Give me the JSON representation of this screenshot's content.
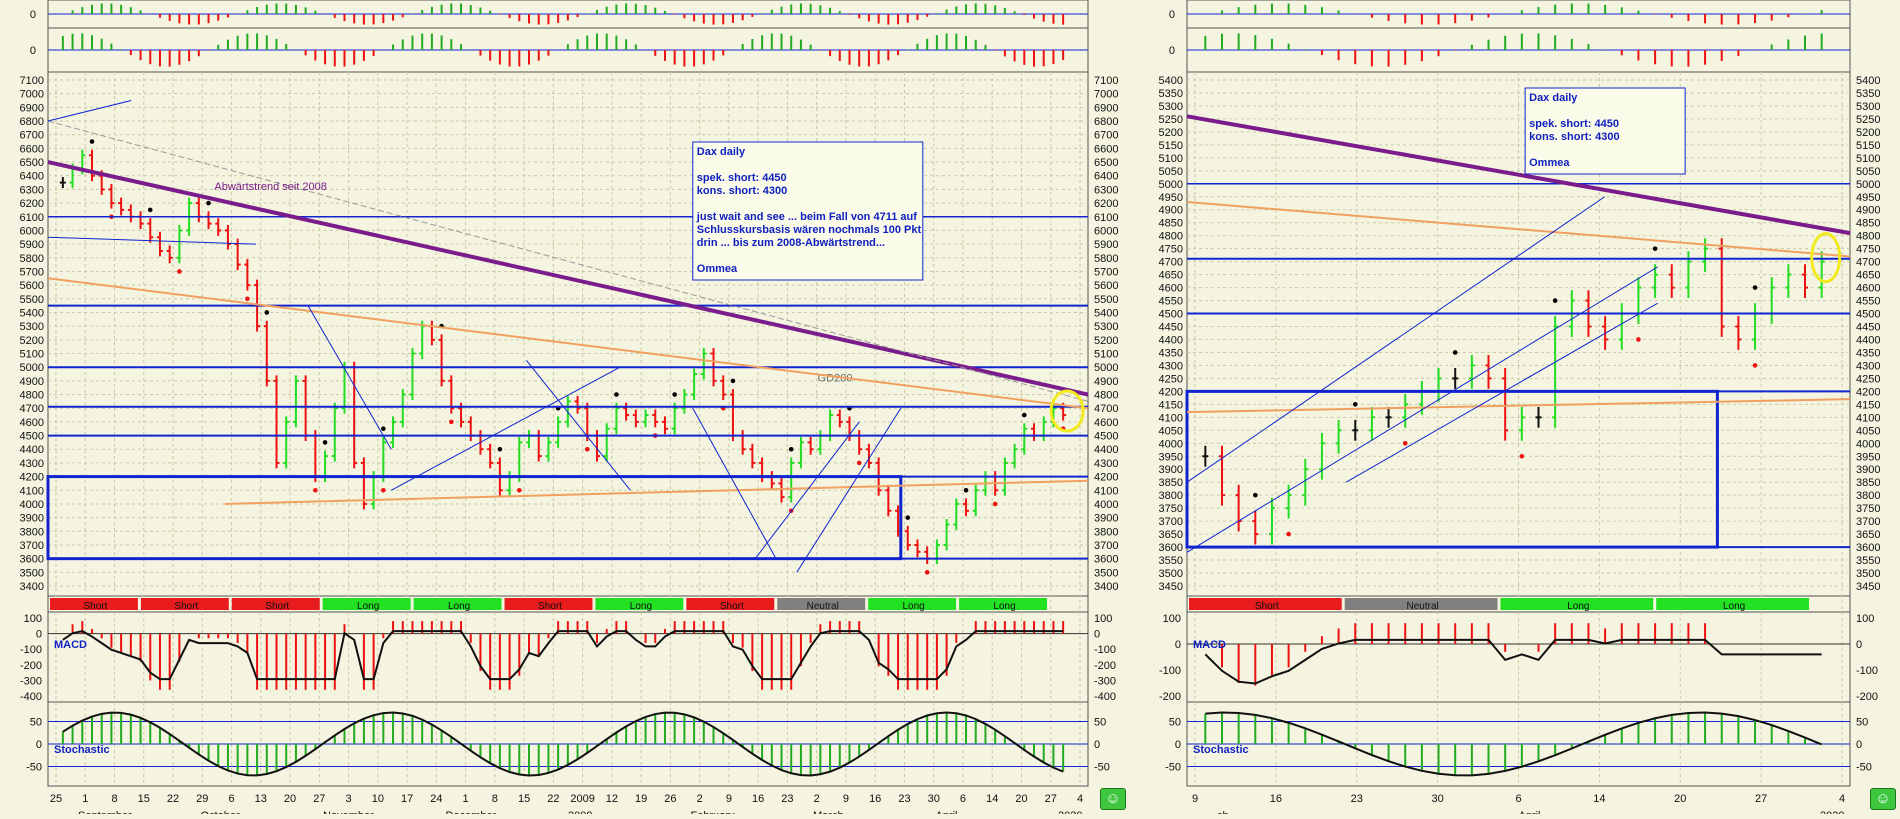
{
  "colors": {
    "background": "#f4f4e0",
    "grid": "#c9c9a6",
    "up": "#22dd22",
    "down": "#ee1111",
    "neutral": "#111111",
    "lines": "#1024d0",
    "trend": "#7b1c8c",
    "orange": "#f0a060",
    "highlight": "#f2ea1c",
    "short_band": "#e81c1c",
    "neutral_band": "#808080",
    "long_band": "#22e022"
  },
  "icons": {
    "smiley": "smiley-face-icon"
  },
  "smiley_glyph": "☺",
  "left_chart": {
    "price_ticks": [
      "7100",
      "7000",
      "6900",
      "6800",
      "6700",
      "6600",
      "6500",
      "6400",
      "6300",
      "6200",
      "6100",
      "6000",
      "5900",
      "5800",
      "5700",
      "5600",
      "5500",
      "5400",
      "5300",
      "5200",
      "5100",
      "5000",
      "4900",
      "4800",
      "4700",
      "4600",
      "4500",
      "4400",
      "4300",
      "4200",
      "4100",
      "4000",
      "3900",
      "3800",
      "3700",
      "3600",
      "3500",
      "3400"
    ],
    "annotation": [
      "Dax daily",
      "",
      "spek. short: 4450",
      "kons. short: 4300",
      "",
      "just wait and see ... beim Fall von 4711 auf",
      "Schlusskursbasis wären nochmals 100 Pkt",
      "drin ... bis zum 2008-Abwärtstrend...",
      "",
      "Ommea"
    ],
    "trend_label": "Abwärtstrend seit 2008",
    "ma_label": "GD200",
    "regime": [
      "Short",
      "Short",
      "Short",
      "Long",
      "Long",
      "Short",
      "Long",
      "Short",
      "Neutral",
      "Long",
      "Long"
    ],
    "macd_label": "MACD",
    "macd_ticks": [
      "100",
      "0",
      "-100",
      "-200",
      "-300",
      "-400"
    ],
    "stoch_label": "Stochastic",
    "stoch_ticks": [
      "50",
      "0",
      "-50"
    ],
    "top_ticks": [
      "0",
      "0"
    ],
    "day_labels": [
      "25",
      "1",
      "8",
      "15",
      "22",
      "29",
      "6",
      "13",
      "20",
      "27",
      "3",
      "10",
      "17",
      "24",
      "1",
      "8",
      "15",
      "22",
      "2009",
      "12",
      "19",
      "26",
      "2",
      "9",
      "16",
      "23",
      "2",
      "9",
      "16",
      "23",
      "30",
      "6",
      "14",
      "20",
      "27",
      "4"
    ],
    "month_labels": [
      "September",
      "October",
      "November",
      "December",
      "2009",
      "February",
      "March",
      "April",
      "2020"
    ]
  },
  "right_chart": {
    "price_ticks": [
      "5400",
      "5350",
      "5300",
      "5250",
      "5200",
      "5150",
      "5100",
      "5050",
      "5000",
      "4950",
      "4900",
      "4850",
      "4800",
      "4750",
      "4700",
      "4650",
      "4600",
      "4550",
      "4500",
      "4450",
      "4400",
      "4350",
      "4300",
      "4250",
      "4200",
      "4150",
      "4100",
      "4050",
      "4000",
      "3950",
      "3900",
      "3850",
      "3800",
      "3750",
      "3700",
      "3650",
      "3600",
      "3550",
      "3500",
      "3450"
    ],
    "annotation": [
      "Dax daily",
      "",
      "spek. short: 4450",
      "kons. short: 4300",
      "",
      "Ommea"
    ],
    "regime": [
      "Short",
      "Neutral",
      "Long",
      "Long"
    ],
    "macd_label": "MACD",
    "macd_ticks": [
      "100",
      "0",
      "-100",
      "-200"
    ],
    "stoch_label": "Stochastic",
    "stoch_ticks": [
      "50",
      "0",
      "-50"
    ],
    "top_ticks": [
      "0",
      "0"
    ],
    "day_labels": [
      "9",
      "16",
      "23",
      "30",
      "6",
      "14",
      "20",
      "27",
      "4"
    ],
    "month_labels": [
      "ch",
      "April",
      "2020"
    ]
  },
  "chart_data": [
    {
      "type": "candlestick",
      "title": "Dax daily",
      "ylim": [
        3400,
        7100
      ],
      "series": [
        {
          "name": "Dax daily",
          "close": [
            6350,
            6450,
            6550,
            6400,
            6300,
            6200,
            6150,
            6100,
            6050,
            5950,
            5850,
            5800,
            6000,
            6200,
            6100,
            6050,
            6000,
            5900,
            5750,
            5600,
            5300,
            4900,
            4300,
            4600,
            4900,
            4500,
            4200,
            4350,
            4700,
            5000,
            4300,
            4000,
            4200,
            4450,
            4600,
            4800,
            5100,
            5300,
            5200,
            4900,
            4700,
            4600,
            4500,
            4400,
            4300,
            4100,
            4200,
            4450,
            4500,
            4350,
            4450,
            4600,
            4750,
            4700,
            4500,
            4350,
            4550,
            4700,
            4650,
            4600,
            4650,
            4600,
            4550,
            4700,
            4800,
            4950,
            5100,
            4900,
            4800,
            4500,
            4400,
            4300,
            4200,
            4150,
            4050,
            4300,
            4450,
            4400,
            4500,
            4650,
            4600,
            4500,
            4400,
            4300,
            4100,
            3950,
            3800,
            3700,
            3650,
            3600,
            3700,
            3850,
            4000,
            3950,
            4100,
            4200,
            4100,
            4300,
            4400,
            4550,
            4500,
            4600,
            4700,
            4650
          ]
        }
      ],
      "lines": [
        {
          "name": "Abwärtstrend seit 2008",
          "from": 6500,
          "to": 4800
        },
        {
          "name": "GD200",
          "from": 6800,
          "to": 4750
        }
      ],
      "levels": [
        6100,
        5450,
        5000,
        4711,
        4500,
        4200,
        3600
      ]
    },
    {
      "type": "candlestick",
      "title": "Dax daily",
      "ylim": [
        3450,
        5400
      ],
      "series": [
        {
          "name": "Dax daily",
          "close": [
            3950,
            3800,
            3700,
            3650,
            3750,
            3800,
            3900,
            4000,
            4050,
            4050,
            4100,
            4100,
            4150,
            4200,
            4250,
            4250,
            4300,
            4250,
            4050,
            4100,
            4100,
            4450,
            4550,
            4450,
            4400,
            4500,
            4600,
            4650,
            4600,
            4700,
            4750,
            4450,
            4400,
            4500,
            4600,
            4650,
            4600,
            4700
          ]
        }
      ],
      "levels": [
        5000,
        4711,
        4500,
        4200,
        3600
      ]
    }
  ]
}
